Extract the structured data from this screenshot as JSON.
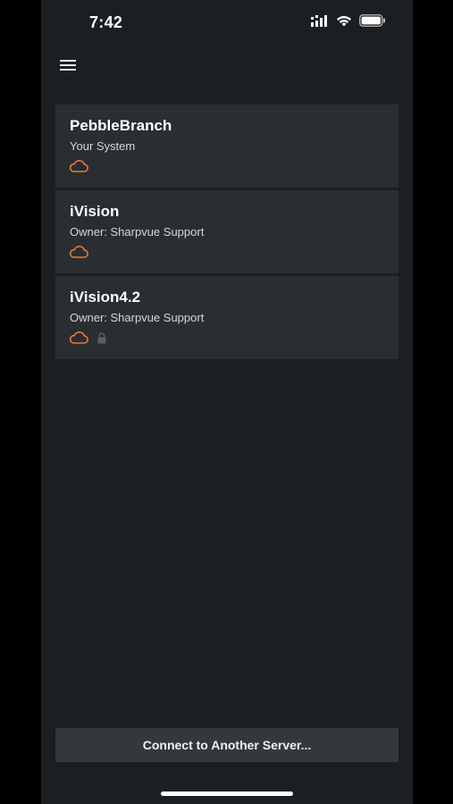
{
  "status_bar": {
    "time": "7:42",
    "icons": [
      "cellular-signal-icon",
      "wifi-icon",
      "battery-icon"
    ]
  },
  "header": {
    "menu_icon": "hamburger-menu-icon"
  },
  "servers": [
    {
      "name": "PebbleBranch",
      "owner": "Your System",
      "icons": [
        "cloud-icon"
      ],
      "locked": false
    },
    {
      "name": "iVision",
      "owner": "Owner: Sharpvue Support",
      "icons": [
        "cloud-icon"
      ],
      "locked": false
    },
    {
      "name": "iVision4.2",
      "owner": "Owner: Sharpvue Support",
      "icons": [
        "cloud-icon",
        "lock-icon"
      ],
      "locked": true
    }
  ],
  "footer": {
    "connect_label": "Connect to Another Server..."
  },
  "colors": {
    "background": "#1c1f22",
    "card": "#2a2e32",
    "button": "#33383d",
    "accent_cloud": "#e5793a",
    "lock_gray": "#5a5f64",
    "text_primary": "#ffffff",
    "text_secondary": "#d6d6d6"
  }
}
